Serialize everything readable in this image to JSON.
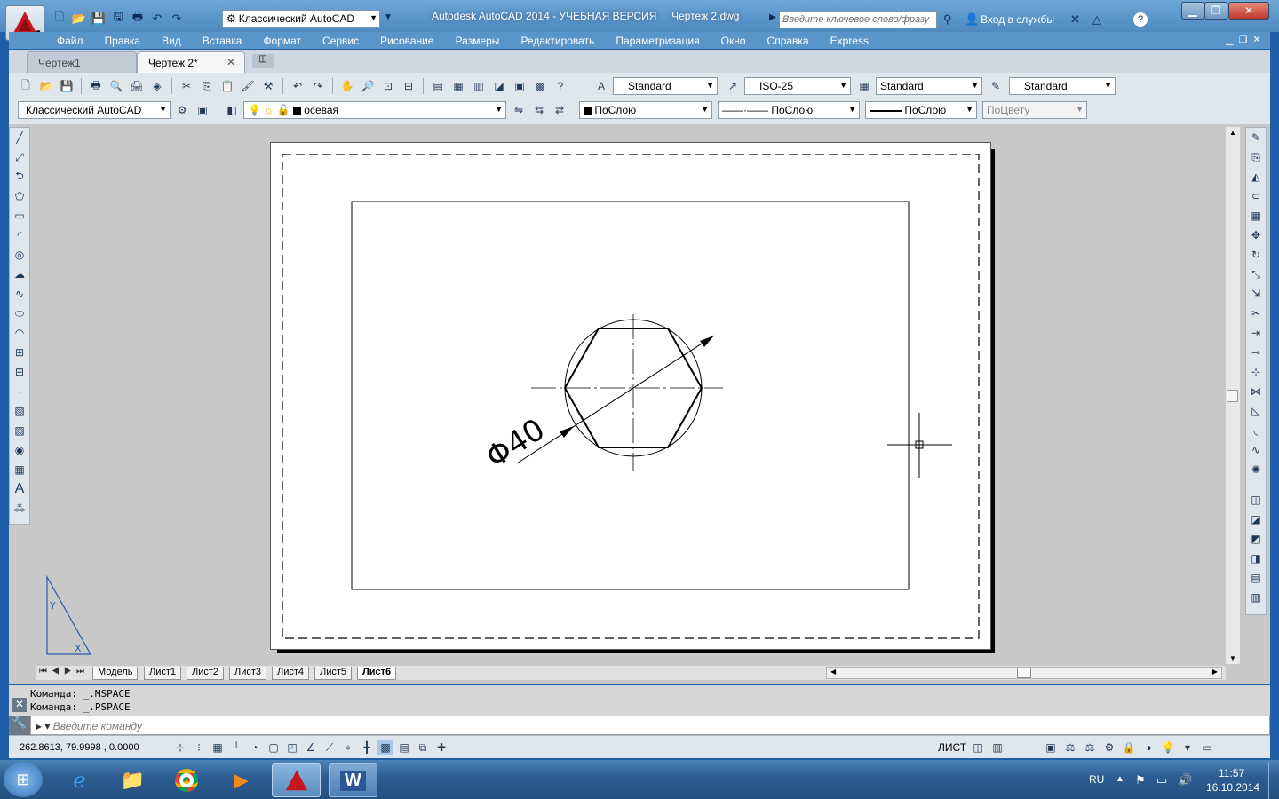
{
  "window": {
    "title": "Autodesk AutoCAD 2014 - УЧЕБНАЯ ВЕРСИЯ     Чертеж 2.dwg",
    "workspace": "Классический AutoCAD",
    "search_placeholder": "Введите ключевое слово/фразу",
    "login": "Вход в службы"
  },
  "menu": [
    "Файл",
    "Правка",
    "Вид",
    "Вставка",
    "Формат",
    "Сервис",
    "Рисование",
    "Размеры",
    "Редактировать",
    "Параметризация",
    "Окно",
    "Справка",
    "Express"
  ],
  "doc_tabs": [
    {
      "label": "Чертеж1",
      "active": false
    },
    {
      "label": "Чертеж 2*",
      "active": true
    }
  ],
  "styles": {
    "text": "Standard",
    "dim": "ISO-25",
    "table": "Standard",
    "mleader": "Standard"
  },
  "layers": {
    "workspace": "Классический AutoCAD",
    "layer": "осевая",
    "color": "ПоСлою",
    "linetype": "ПоСлою",
    "lineweight": "ПоСлою",
    "plotstyle": "ПоЦвету"
  },
  "drawing": {
    "dimension_text": "Φ40"
  },
  "layout_tabs": [
    "Модель",
    "Лист1",
    "Лист2",
    "Лист3",
    "Лист4",
    "Лист5",
    "Лист6"
  ],
  "command": {
    "history": [
      "Команда:  _.MSPACE",
      "Команда:  _.PSPACE"
    ],
    "prompt_placeholder": "Введите команду"
  },
  "status": {
    "coords": "262.8613, 79.9998 , 0.0000",
    "space": "ЛИСТ"
  },
  "taskbar": {
    "lang": "RU",
    "time": "11:57",
    "date": "16.10.2014"
  },
  "colors": {
    "accent": "#5a95c9",
    "autocad_red": "#c4161c"
  }
}
